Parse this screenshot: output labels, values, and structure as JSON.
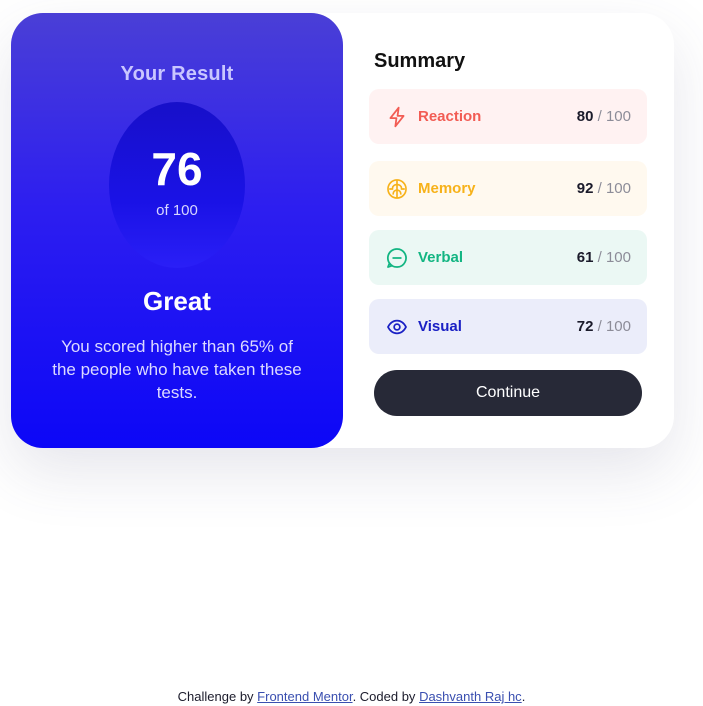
{
  "result": {
    "title": "Your Result",
    "score": "76",
    "of_label": "of 100",
    "grade": "Great",
    "description": "You scored higher than 65% of the people who have taken these tests."
  },
  "summary": {
    "title": "Summary",
    "items": [
      {
        "label": "Reaction",
        "score": "80",
        "max": "/ 100",
        "icon": "lightning-icon",
        "color": "#f25c54",
        "bg": "#fff2f2"
      },
      {
        "label": "Memory",
        "score": "92",
        "max": "/ 100",
        "icon": "brain-icon",
        "color": "#f7b21a",
        "bg": "#fff9ef"
      },
      {
        "label": "Verbal",
        "score": "61",
        "max": "/ 100",
        "icon": "chat-bubble-icon",
        "color": "#13b582",
        "bg": "#ebf8f4"
      },
      {
        "label": "Visual",
        "score": "72",
        "max": "/ 100",
        "icon": "eye-icon",
        "color": "#1a20c4",
        "bg": "#ebedfa"
      }
    ],
    "continue_label": "Continue"
  },
  "footer": {
    "prefix": "Challenge by ",
    "link1": "Frontend Mentor",
    "middle": ". Coded by ",
    "link2": "Dashvanth Raj hc",
    "suffix": "."
  }
}
